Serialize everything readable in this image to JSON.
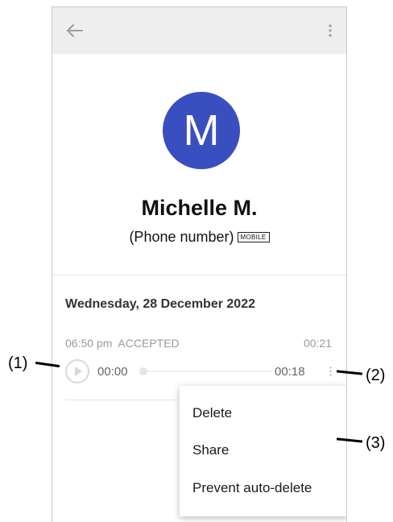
{
  "header": {
    "back_icon": "arrow-left-icon",
    "more_icon": "more-vert-icon"
  },
  "contact": {
    "avatar_letter": "M",
    "avatar_color": "#3a4fbf",
    "name": "Michelle M.",
    "phone": "(Phone number)",
    "phone_type": "MOBILE"
  },
  "history": {
    "date": "Wednesday, 28 December 2022",
    "call": {
      "time_status": "06:50 pm  ACCEPTED",
      "duration": "00:21"
    },
    "player": {
      "play_icon": "play-icon",
      "position": "00:00",
      "total": "00:18",
      "progress": 0
    }
  },
  "context_menu": {
    "items": [
      "Delete",
      "Share",
      "Prevent auto-delete"
    ]
  },
  "callouts": {
    "one": "(1)",
    "two": "(2)",
    "three": "(3)"
  }
}
